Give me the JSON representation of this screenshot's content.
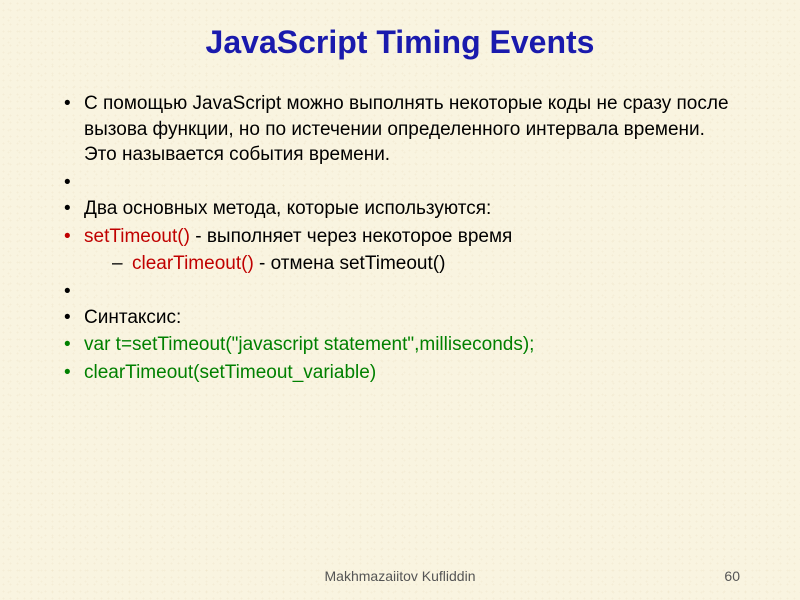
{
  "title": "JavaScript Timing Events",
  "bullets": {
    "intro": "С помощью JavaScript можно выполнять некоторые коды не сразу после вызова функции, но по истечении определенного интервала времени. Это называется события времени.",
    "methods_heading": "Два основных метода, которые используются:",
    "settimeout_code": "setTimeout()",
    "settimeout_rest": " - выполняет через некоторое время",
    "cleartimeout_code": "clearTimeout()",
    "cleartimeout_rest": " - отмена setTimeout()",
    "syntax_heading": "Синтаксис:",
    "syntax_line1": "var t=setTimeout(\"javascript statement\",milliseconds);",
    "syntax_line2": "clearTimeout(setTimeout_variable)"
  },
  "footer": {
    "author": "Makhmazaiitov Kufliddin",
    "page": "60"
  }
}
